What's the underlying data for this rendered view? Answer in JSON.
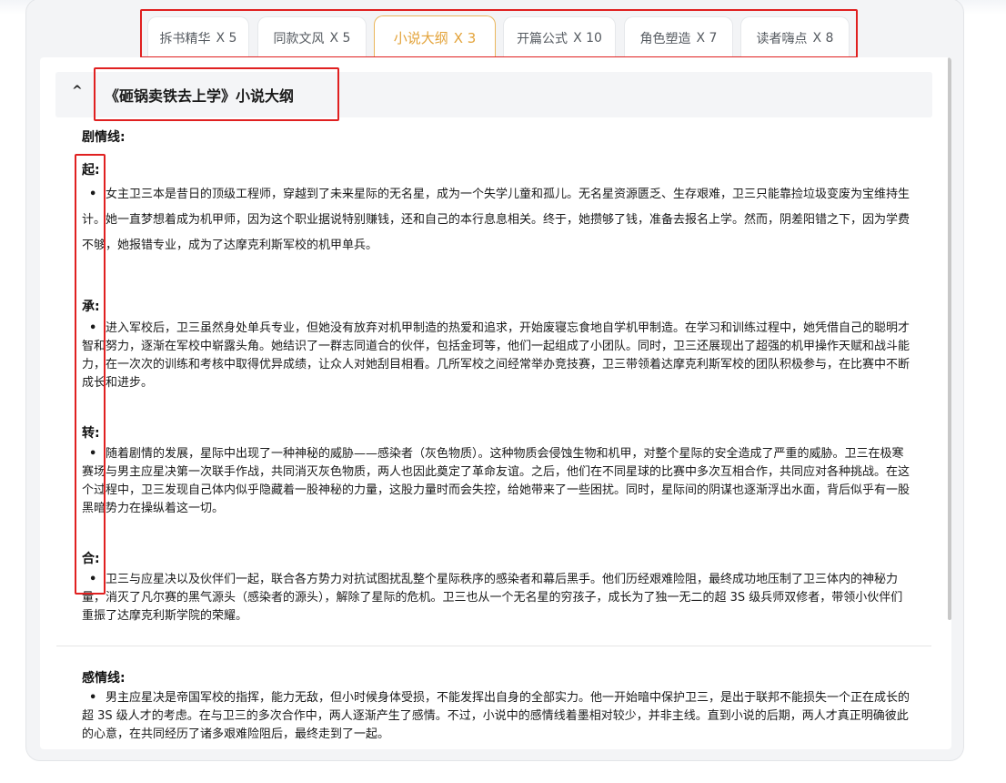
{
  "tabs": [
    {
      "label": "拆书精华",
      "count": "X 5",
      "active": false
    },
    {
      "label": "同款文风",
      "count": "X 5",
      "active": false
    },
    {
      "label": "小说大纲",
      "count": "X 3",
      "active": true
    },
    {
      "label": "开篇公式",
      "count": "X 10",
      "active": false
    },
    {
      "label": "角色塑造",
      "count": "X 7",
      "active": false
    },
    {
      "label": "读者嗨点",
      "count": "X 8",
      "active": false
    }
  ],
  "section": {
    "caret": "^",
    "title": "《砸锅卖铁去上学》小说大纲"
  },
  "plot": {
    "heading": "剧情线:",
    "qi": {
      "label": "起:",
      "text": "女主卫三本是昔日的顶级工程师，穿越到了未来星际的无名星，成为一个失学儿童和孤儿。无名星资源匮乏、生存艰难，卫三只能靠捡垃圾变废为宝维持生计。她一直梦想着成为机甲师，因为这个职业据说特别赚钱，还和自己的本行息息相关。终于，她攒够了钱，准备去报名上学。然而，阴差阳错之下，因为学费不够，她报错专业，成为了达摩克利斯军校的机甲单兵。"
    },
    "cheng": {
      "label": "承:",
      "text": "进入军校后，卫三虽然身处单兵专业，但她没有放弃对机甲制造的热爱和追求，开始废寝忘食地自学机甲制造。在学习和训练过程中，她凭借自己的聪明才智和努力，逐渐在军校中崭露头角。她结识了一群志同道合的伙伴，包括金珂等，他们一起组成了小团队。同时，卫三还展现出了超强的机甲操作天赋和战斗能力，在一次次的训练和考核中取得优异成绩，让众人对她刮目相看。几所军校之间经常举办竞技赛，卫三带领着达摩克利斯军校的团队积极参与，在比赛中不断成长和进步。"
    },
    "zhuan": {
      "label": "转:",
      "text": "随着剧情的发展，星际中出现了一种神秘的威胁——感染者（灰色物质）。这种物质会侵蚀生物和机甲，对整个星际的安全造成了严重的威胁。卫三在极寒赛场与男主应星决第一次联手作战，共同消灭灰色物质，两人也因此奠定了革命友谊。之后，他们在不同星球的比赛中多次互相合作，共同应对各种挑战。在这个过程中，卫三发现自己体内似乎隐藏着一股神秘的力量，这股力量时而会失控，给她带来了一些困扰。同时，星际间的阴谋也逐渐浮出水面，背后似乎有一股黑暗势力在操纵着这一切。"
    },
    "he": {
      "label": "合:",
      "text": "卫三与应星决以及伙伴们一起，联合各方势力对抗试图扰乱整个星际秩序的感染者和幕后黑手。他们历经艰难险阻，最终成功地压制了卫三体内的神秘力量，消灭了凡尔赛的黑气源头（感染者的源头），解除了星际的危机。卫三也从一个无名星的穷孩子，成长为了独一无二的超 3S 级兵师双修者，带领小伙伴们重振了达摩克利斯学院的荣耀。"
    }
  },
  "romance": {
    "heading": "感情线:",
    "text": "男主应星决是帝国军校的指挥，能力无敌，但小时候身体受损，不能发挥出自身的全部实力。他一开始暗中保护卫三，是出于联邦不能损失一个正在成长的超 3S 级人才的考虑。在与卫三的多次合作中，两人逐渐产生了感情。不过，小说中的感情线着墨相对较少，并非主线。直到小说的后期，两人才真正明确彼此的心意，在共同经历了诸多艰难险阻后，最终走到了一起。"
  }
}
